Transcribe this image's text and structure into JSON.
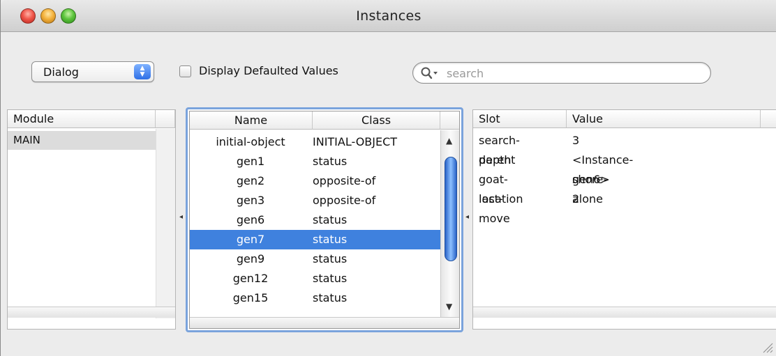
{
  "window": {
    "title": "Instances"
  },
  "toolbar": {
    "view_select": {
      "selected": "Dialog"
    },
    "defaulted_checkbox": {
      "label": "Display Defaulted Values",
      "checked": false
    },
    "search": {
      "placeholder": "search",
      "value": ""
    }
  },
  "modules": {
    "header": "Module",
    "rows": [
      "MAIN"
    ],
    "selected": "MAIN"
  },
  "instances": {
    "columns": {
      "name": "Name",
      "class": "Class"
    },
    "rows": [
      {
        "name": "initial-object",
        "class": "INITIAL-OBJECT"
      },
      {
        "name": "gen1",
        "class": "status"
      },
      {
        "name": "gen2",
        "class": "opposite-of"
      },
      {
        "name": "gen3",
        "class": "opposite-of"
      },
      {
        "name": "gen6",
        "class": "status"
      },
      {
        "name": "gen7",
        "class": "status"
      },
      {
        "name": "gen9",
        "class": "status"
      },
      {
        "name": "gen12",
        "class": "status"
      },
      {
        "name": "gen15",
        "class": "status"
      }
    ],
    "selected": "gen7"
  },
  "slots": {
    "columns": {
      "slot": "Slot",
      "value": "Value"
    },
    "rows": [
      {
        "slot": "search-depth",
        "value": "3"
      },
      {
        "slot": "parent",
        "value": "<Instance-gen6>"
      },
      {
        "slot": "goat-location",
        "value": "shore-2"
      },
      {
        "slot": "last-move",
        "value": "alone"
      }
    ]
  },
  "colors": {
    "selection": "#3f81de",
    "focus_ring": "#7aa3dc"
  },
  "icons": [
    "close-button-icon",
    "minimize-button-icon",
    "zoom-button-icon",
    "popup-arrows-icon",
    "search-icon",
    "splitter-grip-icon",
    "resize-grip-icon"
  ]
}
